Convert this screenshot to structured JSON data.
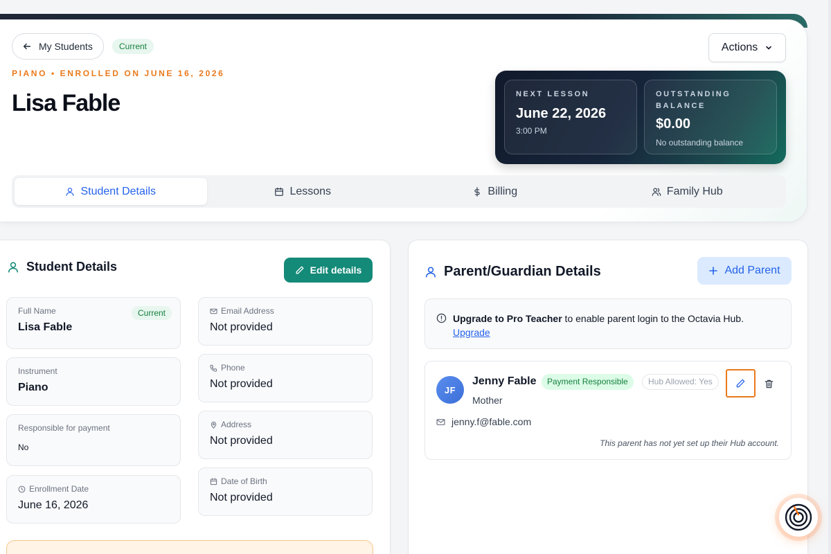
{
  "header": {
    "back_label": "My Students",
    "status": "Current",
    "subtitle": "PIANO • ENROLLED ON JUNE 16, 2026",
    "student_name": "Lisa Fable",
    "actions_label": "Actions"
  },
  "summary": {
    "next_lesson_label": "NEXT LESSON",
    "next_lesson_date": "June 22, 2026",
    "next_lesson_time": "3:00 PM",
    "balance_label_1": "OUTSTANDING",
    "balance_label_2": "BALANCE",
    "balance_value": "$0.00",
    "balance_note": "No outstanding balance"
  },
  "tabs": [
    {
      "label": "Student Details",
      "icon": "user-icon",
      "active": true
    },
    {
      "label": "Lessons",
      "icon": "calendar-icon",
      "active": false
    },
    {
      "label": "Billing",
      "icon": "dollar-icon",
      "active": false
    },
    {
      "label": "Family Hub",
      "icon": "users-icon",
      "active": false
    }
  ],
  "student_details": {
    "title": "Student Details",
    "edit_label": "Edit details",
    "fields": {
      "full_name": {
        "label": "Full Name",
        "value": "Lisa Fable",
        "badge": "Current"
      },
      "email": {
        "label": "Email Address",
        "value": "Not provided"
      },
      "instrument": {
        "label": "Instrument",
        "value": "Piano"
      },
      "phone": {
        "label": "Phone",
        "value": "Not provided"
      },
      "responsible": {
        "label": "Responsible for payment",
        "value": "No"
      },
      "address": {
        "label": "Address",
        "value": "Not provided"
      },
      "enrollment": {
        "label": "Enrollment Date",
        "value": "June 16, 2026"
      },
      "dob": {
        "label": "Date of Birth",
        "value": "Not provided"
      }
    }
  },
  "parents": {
    "title": "Parent/Guardian Details",
    "add_label": "Add Parent",
    "upgrade_bold": "Upgrade to Pro Teacher",
    "upgrade_text": " to enable parent login to the Octavia Hub.",
    "upgrade_link": "Upgrade",
    "parent": {
      "initials": "JF",
      "name": "Jenny Fable",
      "relation": "Mother",
      "payment_badge": "Payment Responsible",
      "hub_badge": "Hub Allowed: Yes",
      "email": "jenny.f@fable.com",
      "hub_note": "This parent has not yet set up their Hub account."
    }
  },
  "colors": {
    "accent_orange": "#ea7a1c",
    "primary_blue": "#2563eb",
    "teal_button": "#148a78",
    "status_green": "#15803d"
  }
}
